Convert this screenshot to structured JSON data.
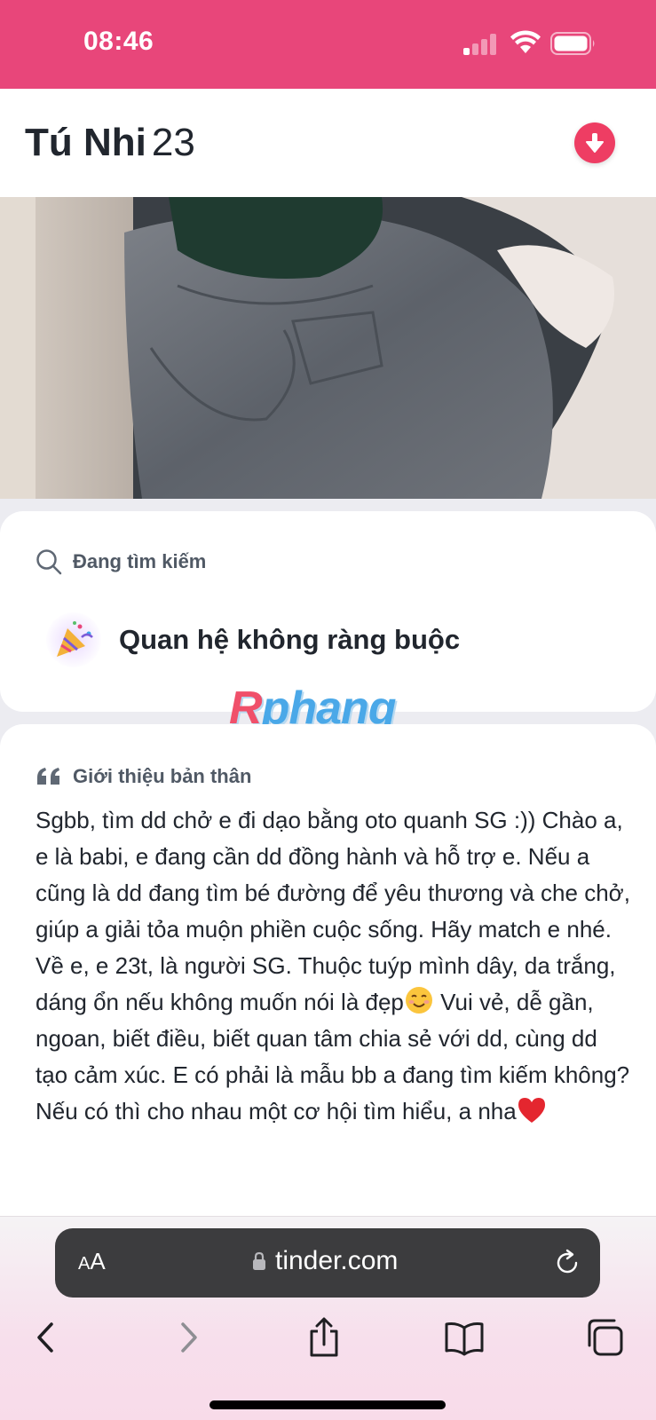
{
  "status_bar": {
    "time": "08:46",
    "signal_bars_active": 1,
    "signal_bars_total": 4
  },
  "profile": {
    "name": "Tú Nhi",
    "age": "23"
  },
  "looking_for": {
    "label": "Đang tìm kiếm",
    "goal": "Quan hệ không ràng buộc",
    "goal_icon": "party-popper-emoji"
  },
  "watermark": {
    "first_letter": "R",
    "rest": "phang"
  },
  "bio": {
    "label": "Giới thiệu bản thân",
    "text_part1": "Sgbb, tìm dd chở e đi dạo bằng oto quanh SG :)) Chào a, e là babi, e đang cần dd đồng hành và hỗ trợ e. Nếu a cũng là dd đang tìm bé đường để yêu thương và che chở, giúp a giải tỏa muộn phiền cuộc sống. Hãy match e nhé. Về e, e 23t, là người SG. Thuộc tuýp mình dây, da trắng, dáng ổn nếu không muốn nói là đẹp",
    "text_part2": " Vui vẻ, dễ gần, ngoan, biết điều, biết quan tâm chia sẻ với dd, cùng dd tạo cảm xúc. E có phải là mẫu bb a đang tìm kiếm không? Nếu có thì cho nhau một cơ hội tìm hiểu, a nha",
    "emoji_1": "smiling-face-emoji",
    "emoji_2": "red-heart-emoji"
  },
  "browser": {
    "text_size_small": "A",
    "text_size_large": "A",
    "url": "tinder.com"
  },
  "colors": {
    "brand_pink": "#e8467a",
    "collapse_button": "#ee3d63",
    "address_bar": "#3c3c3e"
  }
}
